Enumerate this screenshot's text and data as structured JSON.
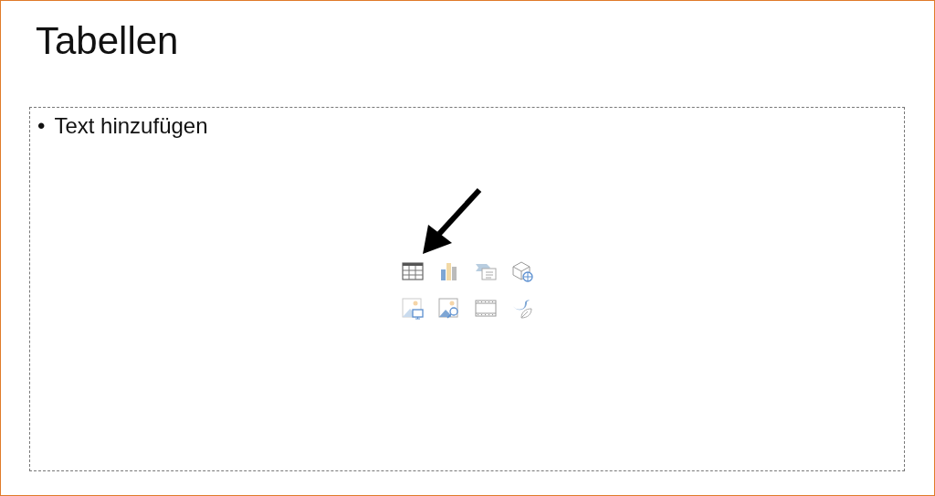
{
  "slide": {
    "title": "Tabellen",
    "content_placeholder": {
      "bullet": "•",
      "text": "Text hinzufügen"
    }
  }
}
